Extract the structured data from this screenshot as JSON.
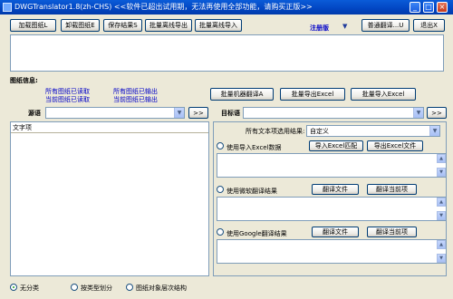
{
  "window": {
    "title": "DWGTranslator1.8(zh-CHS) <<软件已超出试用期，无法再使用全部功能，请购买正版>>",
    "minimize": "_",
    "maximize": "□",
    "close": "×"
  },
  "toolbar": {
    "load_drawing": "加载图纸L",
    "unload_drawing": "卸载图纸E",
    "save_result": "保存结果S",
    "batch_export": "批量离线导出",
    "batch_import": "批量离线导入",
    "register": "注册版",
    "dropdown_arrow": "▼",
    "normal_translate": "普通翻译...U",
    "exit": "退出X"
  },
  "drawing_info": {
    "label": "图纸信息:",
    "all_drawings_read": "所有图纸已读取",
    "all_drawings_output": "所有图纸已输出",
    "current_drawing_read": "当前图纸已读取",
    "current_drawing_output": "当前图纸已输出"
  },
  "actions": {
    "batch_machine_translate": "批量机器翻译A",
    "batch_export_excel": "批量导出Excel",
    "batch_import_excel": "批量导入Excel"
  },
  "source_lang": {
    "label": "源语",
    "value": "",
    "go": ">>"
  },
  "target_lang": {
    "label": "目标语",
    "value": "",
    "go": ">>"
  },
  "text_items": {
    "header": "文字项"
  },
  "result_options": {
    "all_text_label": "所有文本项选用结果:",
    "selected": "自定义",
    "use_excel": "使用导入Excel数据",
    "import_excel_match": "导入Excel匹配",
    "export_excel_file": "导出Excel文件",
    "use_microsoft": "使用微软翻译结果",
    "use_google": "使用Google翻译结果",
    "translate_file": "翻译文件",
    "translate_current": "翻译当前项"
  },
  "grouping": {
    "none": "无分类",
    "by_type": "按类型划分",
    "by_layer": "图纸对象层次结构"
  }
}
